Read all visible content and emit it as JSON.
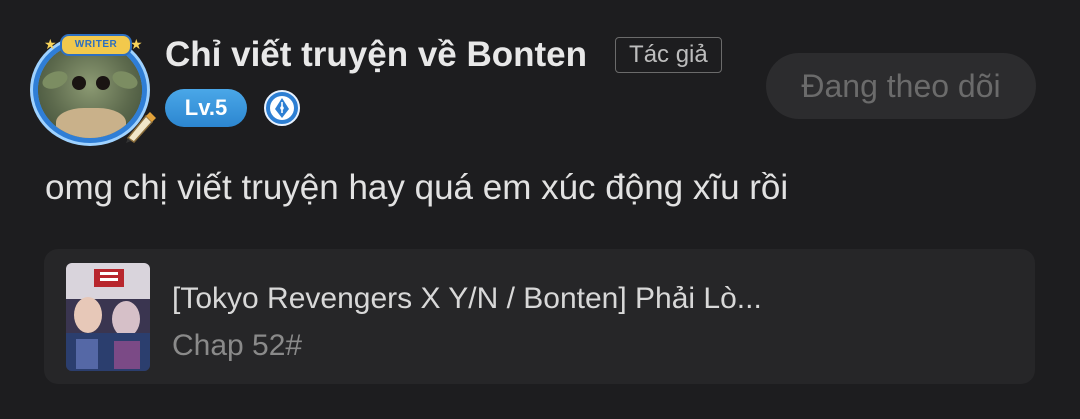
{
  "comment_header": {
    "avatar_banner": "WRITER",
    "username": "Chỉ viết truyện về Bonten",
    "author_tag": "Tác giả",
    "level_badge": "Lv.5",
    "follow_button_label": "Đang theo dõi"
  },
  "comment": {
    "text": "omg chị viết truyện hay quá em xúc động xĩu rồi"
  },
  "story_card": {
    "title": "[Tokyo Revengers X Y/N / Bonten] Phải Lò...",
    "chapter": "Chap 52#"
  },
  "colors": {
    "background": "#1d1d1f",
    "card": "#262628",
    "level_badge": "#3a9be0",
    "follow_button": "#2c2c2e"
  },
  "icons": {
    "writer_pen": "pen-nib-icon",
    "verified_writer": "fountain-pen-badge-icon"
  }
}
